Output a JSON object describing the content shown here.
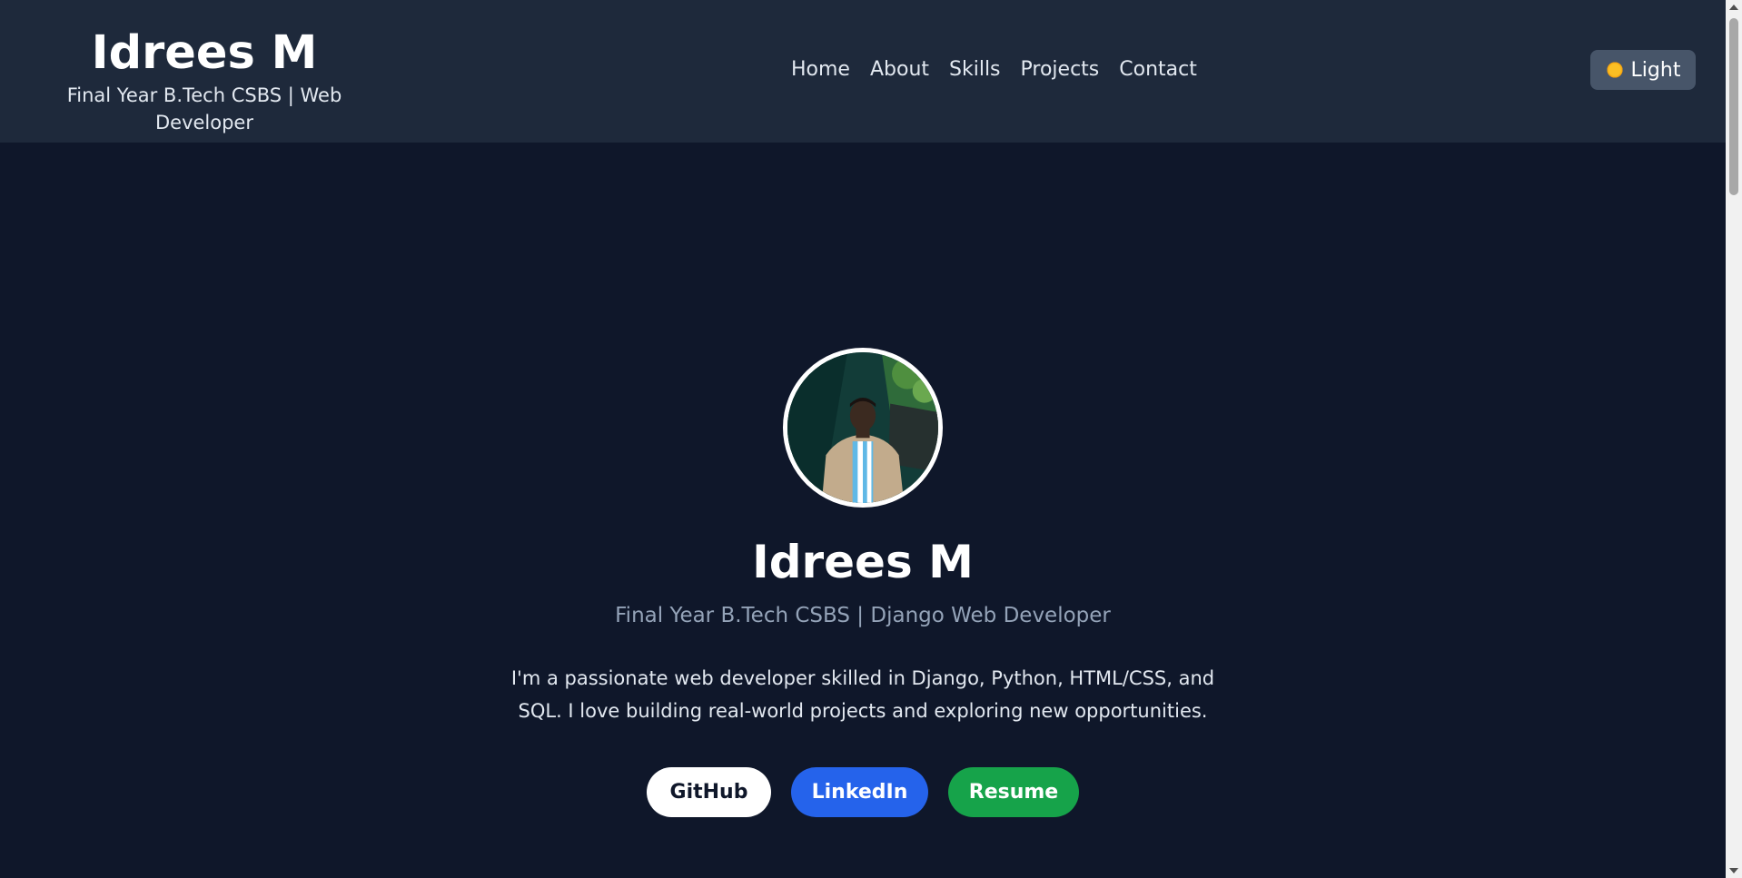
{
  "header": {
    "name": "Idrees M",
    "tagline": "Final Year B.Tech CSBS | Web Developer",
    "nav": [
      "Home",
      "About",
      "Skills",
      "Projects",
      "Contact"
    ],
    "theme_toggle_label": "Light",
    "theme_toggle_icon": "sun-icon"
  },
  "hero": {
    "avatar_icon": "profile-photo",
    "name": "Idrees M",
    "subtitle": "Final Year B.Tech CSBS | Django Web Developer",
    "description": "I'm a passionate web developer skilled in Django, Python, HTML/CSS, and SQL. I love building real-world projects and exploring new opportunities.",
    "buttons": {
      "github": "GitHub",
      "linkedin": "LinkedIn",
      "resume": "Resume"
    }
  },
  "colors": {
    "page_bg": "#0f172a",
    "header_bg": "#1e293b",
    "linkedin": "#2563eb",
    "resume": "#16a34a",
    "subtitle": "#94a3b8"
  }
}
